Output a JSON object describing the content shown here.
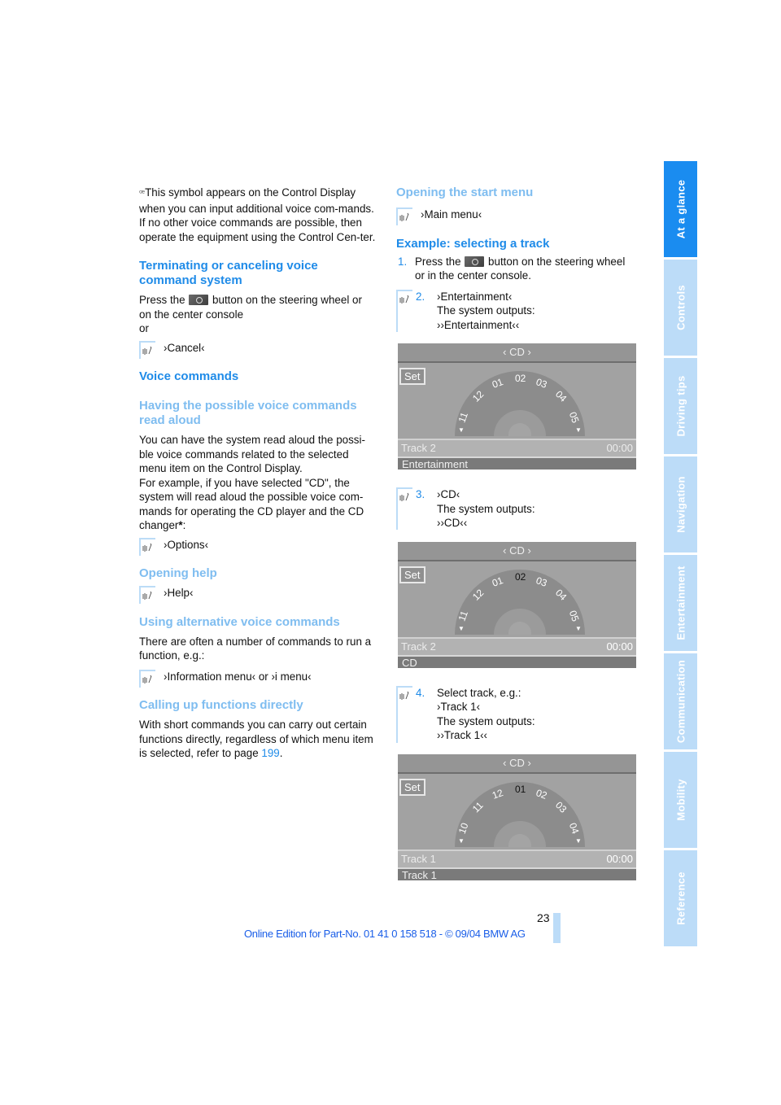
{
  "left": {
    "intro_symbol_text": "This symbol appears on the Control Display when you can input additional voice com-mands.",
    "intro_text2": "If no other voice commands are possible, then operate the equipment using the Control Cen-ter.",
    "terminating": {
      "heading": "Terminating or canceling voice command system",
      "text_before": "Press the",
      "text_after": "button on the steering wheel or on the center console",
      "or": "or",
      "command": "›Cancel‹"
    },
    "voice_commands": {
      "heading": "Voice commands",
      "read_aloud_heading": "Having the possible voice commands read aloud",
      "read_aloud_text1": "You can have the system read aloud the possi-ble voice commands related to the selected menu item on the Control Display.",
      "read_aloud_text2": "For example, if you have selected \"CD\", the system will read aloud the possible voice com-mands for operating the CD player and the CD changer",
      "asterisk": "*",
      "colon": ":",
      "options_command": "›Options‹"
    },
    "opening_help": {
      "heading": "Opening help",
      "command": "›Help‹"
    },
    "alternative": {
      "heading": "Using alternative voice commands",
      "text": "There are often a number of commands to run a function, e.g.:",
      "command": "›Information menu‹  or ›i menu‹"
    },
    "calling_up": {
      "heading": "Calling up functions directly",
      "text": "With short commands you can carry out certain functions directly, regardless of which menu item is selected, refer to page",
      "page_link": "199",
      "period": "."
    }
  },
  "right": {
    "start_menu": {
      "heading": "Opening the start menu",
      "command": "›Main menu‹"
    },
    "example": {
      "heading": "Example: selecting a track",
      "steps": [
        {
          "num": "1.",
          "text_before": "Press the",
          "text_after": "button on the steering wheel or in the center console."
        },
        {
          "num": "2.",
          "line1": "›Entertainment‹",
          "line2": "The system outputs:",
          "line3": "››Entertainment‹‹"
        },
        {
          "num": "3.",
          "line1": "›CD‹",
          "line2": "The system outputs:",
          "line3": "››CD‹‹"
        },
        {
          "num": "4.",
          "line1": "Select track, e.g.:",
          "line2": "›Track 1‹",
          "line3": "The system outputs:",
          "line4": "››Track 1‹‹"
        }
      ]
    },
    "screens": [
      {
        "header": "‹  CD  ›",
        "set": "Set",
        "tracks": [
          "11",
          "12",
          "01",
          "02",
          "03",
          "04",
          "05"
        ],
        "selected": "",
        "track": "Track 2",
        "time": "00:00",
        "footer": "Entertainment"
      },
      {
        "header": "‹  CD  ›",
        "set": "Set",
        "tracks": [
          "11",
          "12",
          "01",
          "02",
          "03",
          "04",
          "05"
        ],
        "selected": "02",
        "track": "Track 2",
        "time": "00:00",
        "footer": "CD"
      },
      {
        "header": "‹  CD  ›",
        "set": "Set",
        "tracks": [
          "10",
          "11",
          "12",
          "01",
          "02",
          "03",
          "04"
        ],
        "selected": "01",
        "track": "Track 1",
        "time": "00:00",
        "footer": "Track 1"
      }
    ]
  },
  "sidebar": {
    "tabs": [
      "At a glance",
      "Controls",
      "Driving tips",
      "Navigation",
      "Entertainment",
      "Communication",
      "Mobility",
      "Reference"
    ],
    "active": "At a glance"
  },
  "page_number": "23",
  "footer": "Online Edition for Part-No. 01 41 0 158 518 - © 09/04 BMW AG",
  "colors": {
    "heading": "#1f8be8",
    "subheading": "#7fbdf0",
    "tab_active": "#1a8cf0",
    "tab_inactive": "#bcdcf8",
    "footer": "#1a5ee8"
  }
}
